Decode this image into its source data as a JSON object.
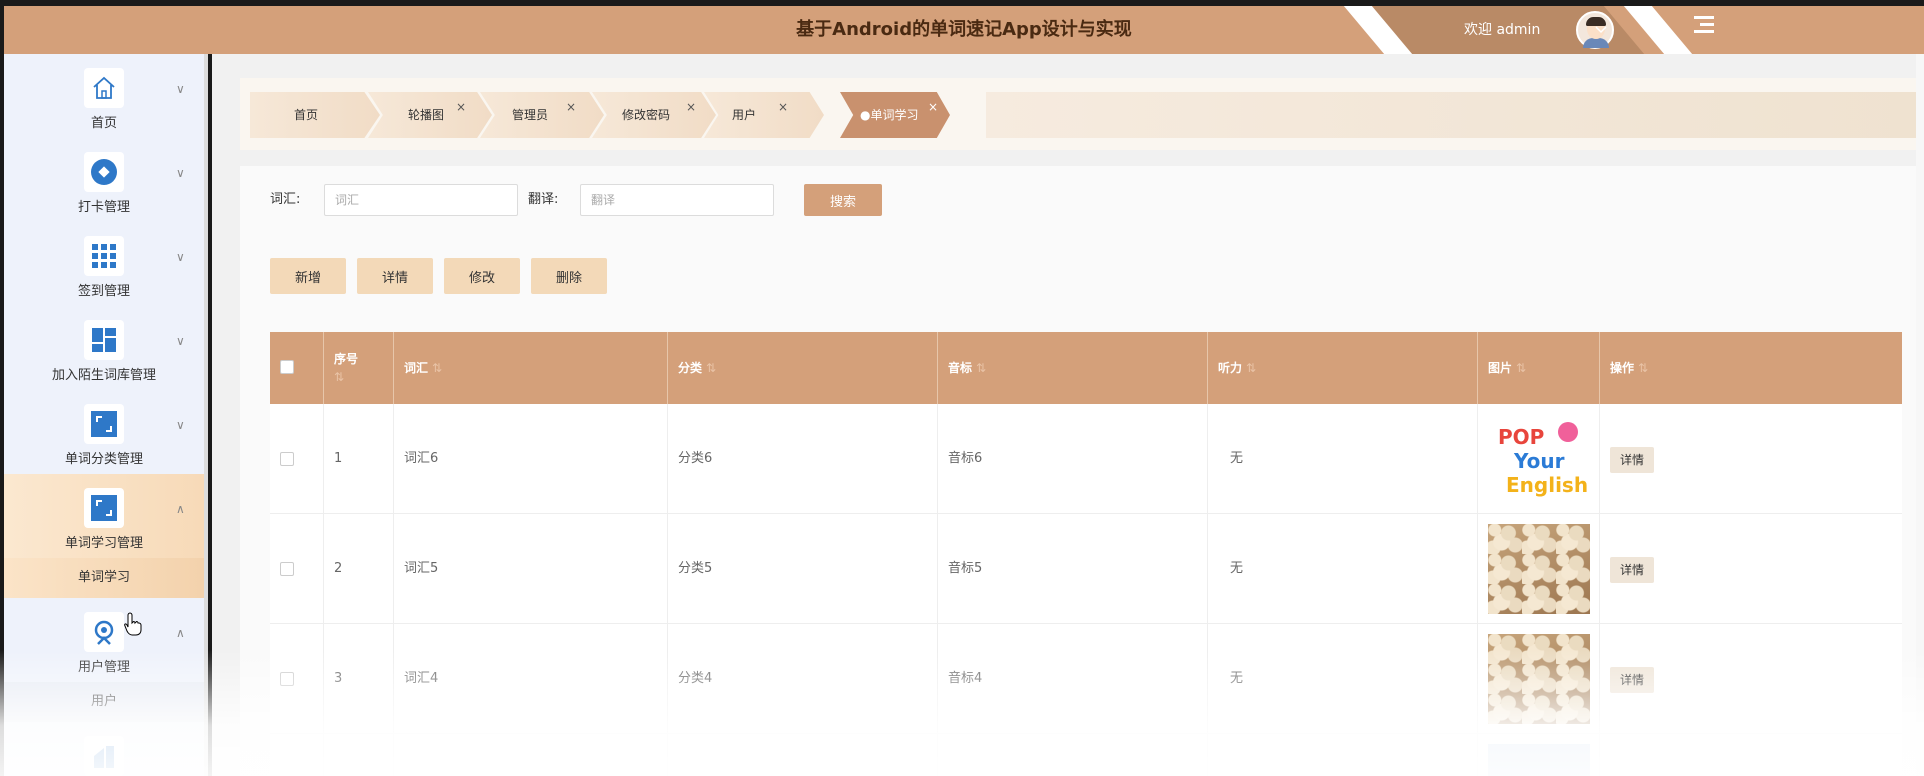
{
  "header": {
    "title": "基于Android的单词速记App设计与实现",
    "welcome": "欢迎 admin",
    "avatar_icon": "user-avatar",
    "menu_toggle_icon": "menu-fold-icon",
    "bg_color": "#d4a07a"
  },
  "sidebar": {
    "items": [
      {
        "label": "首页",
        "icon": "home-icon",
        "arrow": "∨"
      },
      {
        "label": "打卡管理",
        "icon": "checkin-icon",
        "arrow": "∨"
      },
      {
        "label": "签到管理",
        "icon": "grid-icon",
        "arrow": "∨"
      },
      {
        "label": "加入陌生词库管理",
        "icon": "dashboard-icon",
        "arrow": "∨"
      },
      {
        "label": "单词分类管理",
        "icon": "category-icon",
        "arrow": "∨"
      },
      {
        "label": "单词学习管理",
        "icon": "study-icon",
        "arrow": "∧"
      },
      {
        "label": "用户管理",
        "icon": "user-icon",
        "arrow": "∧"
      }
    ],
    "submenus": {
      "study": "单词学习",
      "user": "用户"
    }
  },
  "tabs": [
    {
      "label": "首页",
      "close": ""
    },
    {
      "label": "轮播图",
      "close": "×"
    },
    {
      "label": "管理员",
      "close": "×"
    },
    {
      "label": "修改密码",
      "close": "×"
    },
    {
      "label": "用户",
      "close": "×"
    },
    {
      "label": "●单词学习",
      "close": "×"
    }
  ],
  "search": {
    "vocab_label": "词汇:",
    "vocab_placeholder": "词汇",
    "trans_label": "翻译:",
    "trans_placeholder": "翻译",
    "button": "搜索"
  },
  "actions": {
    "add": "新增",
    "detail": "详情",
    "edit": "修改",
    "delete": "删除"
  },
  "table": {
    "headers": {
      "index": "序号",
      "vocab": "词汇",
      "category": "分类",
      "phonetic": "音标",
      "listening": "听力",
      "image": "图片",
      "ops": "操作"
    },
    "sort_glyph": "⇅",
    "rows": [
      {
        "index": "1",
        "vocab": "词汇6",
        "category": "分类6",
        "phonetic": "音标6",
        "listening": "无",
        "op": "详情"
      },
      {
        "index": "2",
        "vocab": "词汇5",
        "category": "分类5",
        "phonetic": "音标5",
        "listening": "无",
        "op": "详情"
      },
      {
        "index": "3",
        "vocab": "词汇4",
        "category": "分类4",
        "phonetic": "音标4",
        "listening": "无",
        "op": "详情"
      }
    ]
  }
}
